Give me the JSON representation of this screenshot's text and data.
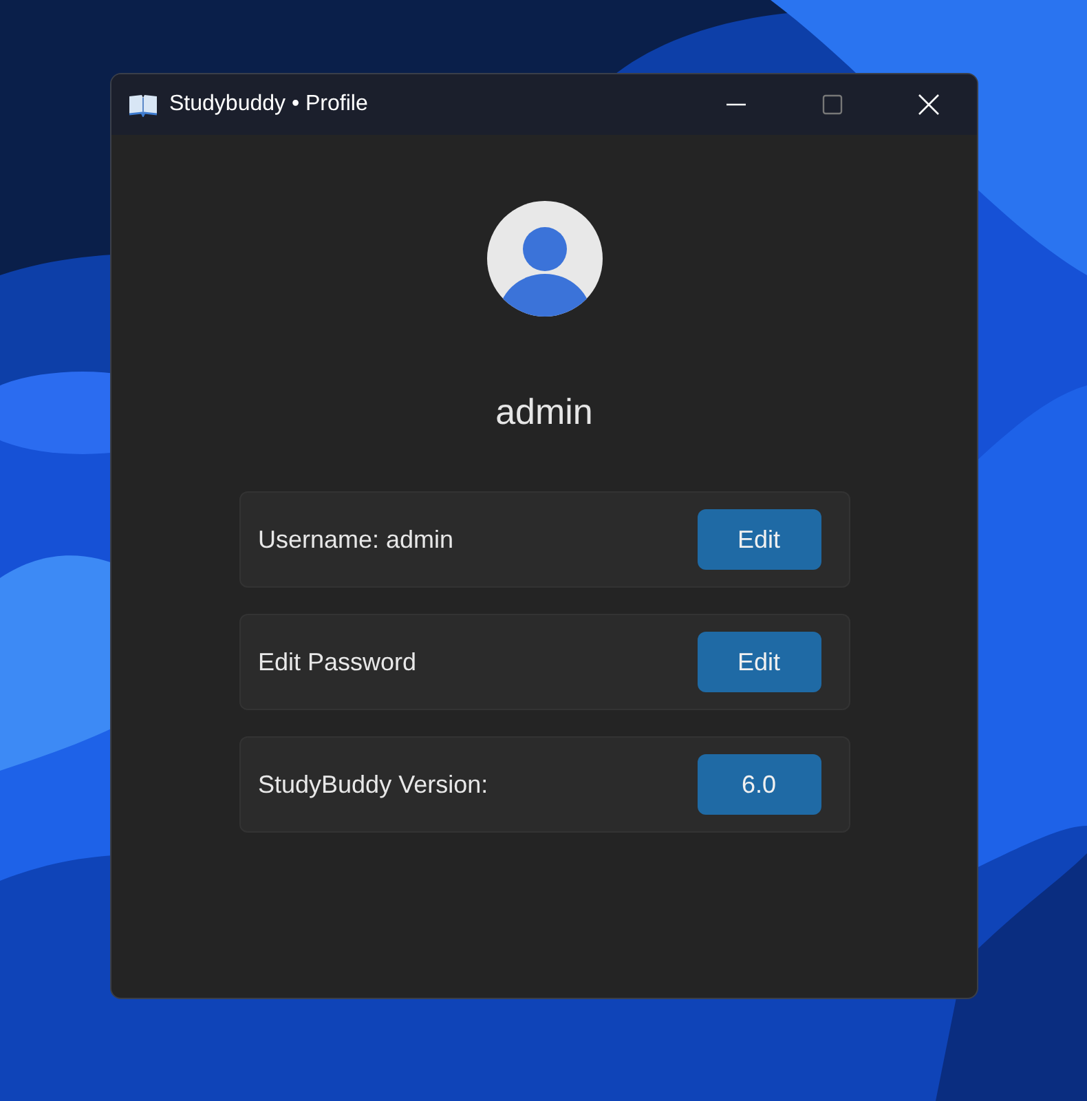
{
  "window": {
    "title": "Studybuddy • Profile"
  },
  "profile": {
    "display_name": "admin"
  },
  "rows": [
    {
      "label": "Username: admin",
      "button": "Edit"
    },
    {
      "label": "Edit Password",
      "button": "Edit"
    },
    {
      "label": "StudyBuddy Version:",
      "button": "6.0"
    }
  ]
}
